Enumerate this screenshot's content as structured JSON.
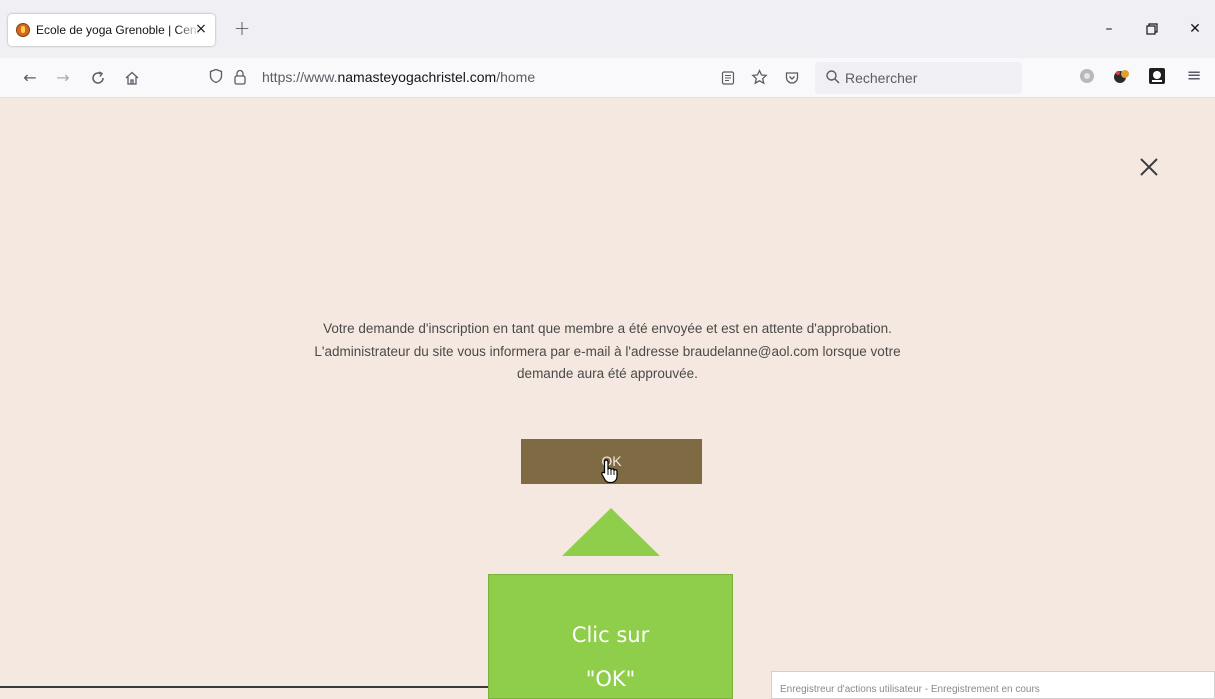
{
  "browser": {
    "tab": {
      "title": "Ecole de yoga Grenoble | Centre de yoga",
      "close": "×"
    },
    "new_tab": "+",
    "window": {
      "minimize": "–",
      "restore": "⧉",
      "close": "✕"
    },
    "nav": {
      "back": "←",
      "forward": "→",
      "reload": "C",
      "home": "⌂"
    },
    "url": {
      "scheme": "https://www.",
      "host": "namasteyogachristel.com",
      "path": "/home"
    },
    "search_placeholder": "Rechercher",
    "extensions": [
      "settings-extension",
      "yoga-extension",
      "crypto-extension"
    ],
    "menu": "≡"
  },
  "dialog": {
    "message_line1": "Votre demande d'inscription en tant que membre a été envoyée et est en attente d'approbation.",
    "message_line2": "L'administrateur du site vous informera par e-mail à l'adresse braudelanne@aol.com lorsque votre",
    "message_line3": "demande aura été approuvée.",
    "ok_label": "OK",
    "close_label": "×"
  },
  "callout": {
    "line1": "Clic sur",
    "line2": "\"OK\""
  },
  "status_bar": "Enregistreur d'actions utilisateur - Enregistrement en cours",
  "colors": {
    "page_bg": "#f4e8e0",
    "ok_button": "#7e6b43",
    "callout": "#8fce4a"
  }
}
